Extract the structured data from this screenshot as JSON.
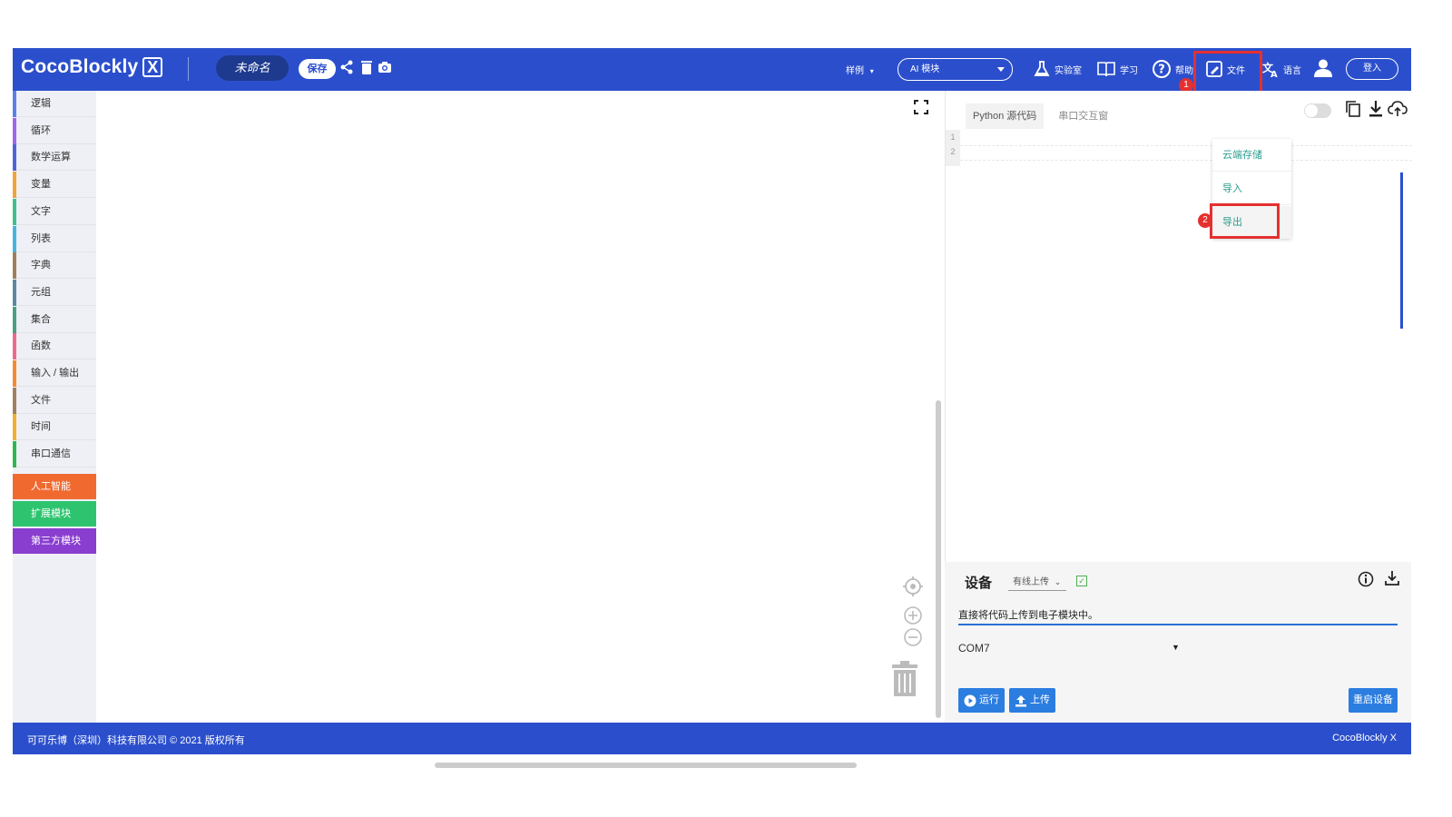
{
  "colors": {
    "brand": "#2b4fcc",
    "highlight": "#e53030",
    "menu_text": "#2a9d8f"
  },
  "header": {
    "logo": "CocoBlockly",
    "logo_x": "X",
    "project_name": "未命名",
    "save": "保存",
    "samples": "样例",
    "ai_select": "AI 模块",
    "lab": "实验室",
    "learn": "学习",
    "help": "帮助",
    "file": "文件",
    "language": "语言",
    "login": "登入",
    "badge_1": "1",
    "badge_2": "2"
  },
  "file_menu": {
    "items": [
      "云端存储",
      "导入",
      "导出"
    ]
  },
  "sidebar": {
    "categories": [
      {
        "label": "逻辑",
        "color": "#5b80e8"
      },
      {
        "label": "循环",
        "color": "#a066e8"
      },
      {
        "label": "数学运算",
        "color": "#5064d8"
      },
      {
        "label": "变量",
        "color": "#f2a33a"
      },
      {
        "label": "文字",
        "color": "#3ec18f"
      },
      {
        "label": "列表",
        "color": "#45b6e0"
      },
      {
        "label": "字典",
        "color": "#a0805a"
      },
      {
        "label": "元组",
        "color": "#5a8aa0"
      },
      {
        "label": "集合",
        "color": "#4aa080"
      },
      {
        "label": "函数",
        "color": "#ef6a8a"
      },
      {
        "label": "输入 / 输出",
        "color": "#f58a30"
      },
      {
        "label": "文件",
        "color": "#a08060"
      },
      {
        "label": "时间",
        "color": "#f0b030"
      },
      {
        "label": "串口通信",
        "color": "#2eb84f"
      }
    ],
    "special": [
      {
        "label": "人工智能",
        "color": "#f06a30"
      },
      {
        "label": "扩展模块",
        "color": "#2ec46f"
      },
      {
        "label": "第三方模块",
        "color": "#8a3ed0"
      }
    ]
  },
  "code_panel": {
    "tabs": [
      "Python 源代码",
      "串口交互窗"
    ],
    "line_numbers": [
      "1",
      "2"
    ]
  },
  "device": {
    "title": "设备",
    "upload_mode": "有线上传",
    "checkbox_mark": "✓",
    "description": "直接将代码上传到电子模块中。",
    "port": "COM7",
    "port_caret": "▼",
    "run": "运行",
    "upload": "上传",
    "restart": "重启设备"
  },
  "footer": {
    "left": "可可乐博（深圳）科技有限公司 © 2021 版权所有",
    "right": "CocoBlockly X"
  }
}
